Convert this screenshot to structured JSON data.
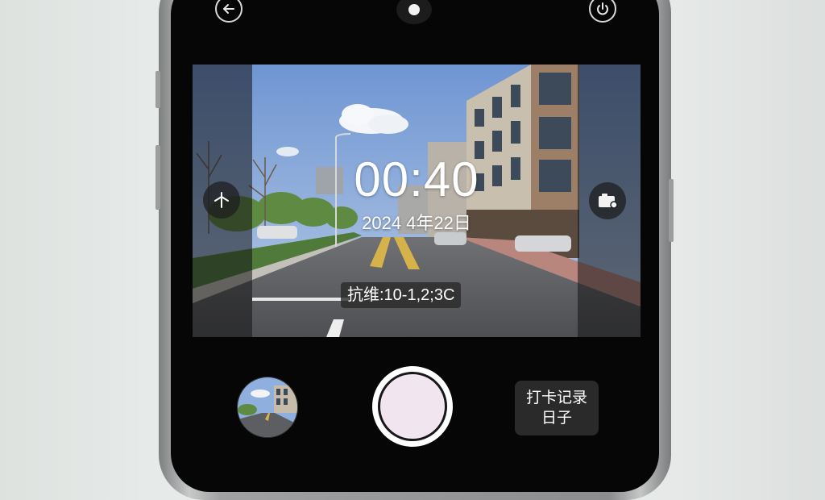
{
  "top_bar": {
    "back_icon": "back-arrow-icon",
    "camera_icon": "front-camera-dot",
    "power_icon": "power-icon"
  },
  "viewfinder": {
    "time": "00:40",
    "date": "2024 4年22日",
    "location": "抗维:10-1,2;3C",
    "left_icon": "airplane-icon",
    "right_icon": "camera-switch-icon"
  },
  "bottom_bar": {
    "gallery_thumbnail": "gallery-thumbnail",
    "shutter": "shutter-button",
    "records_line1": "打卡记录",
    "records_line2": "日子"
  },
  "colors": {
    "sky": "#8eb0df",
    "road": "#5f6063",
    "screen_bg": "#060606",
    "chip_bg": "#282828"
  }
}
